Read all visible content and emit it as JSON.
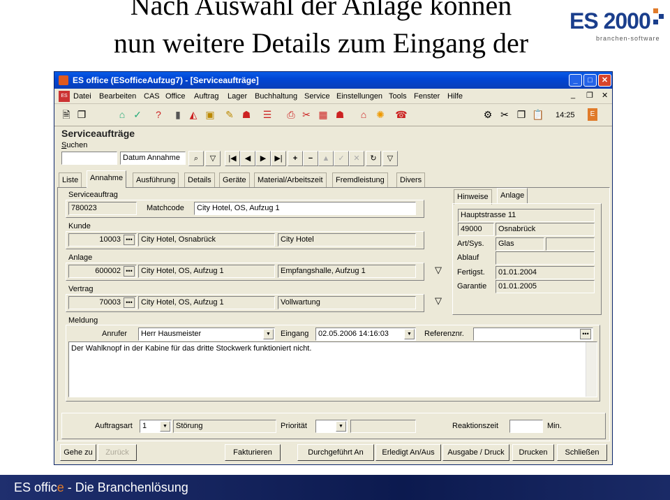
{
  "slide": {
    "title_line1": "Nach Auswahl der Anlage können",
    "title_line2": "nun weitere Details zum Eingang der",
    "logo_text": "ES 2000",
    "logo_sub": "branchen-software",
    "footer": "ES offic",
    "footer_e": "e",
    "footer_rest": " - Die Branchenlösung"
  },
  "window": {
    "title": "ES office (ESofficeAufzug7) - [Serviceaufträge]",
    "menu": [
      "Datei",
      "Bearbeiten",
      "CAS",
      "Office",
      "Auftrag",
      "Lager",
      "Buchhaltung",
      "Service",
      "Einstellungen",
      "Tools",
      "Fenster",
      "Hilfe"
    ],
    "clock": "14:25"
  },
  "form": {
    "title": "Serviceaufträge",
    "search_label": "Suchen",
    "search_value": "",
    "search_field": "Datum Annahme",
    "tabs": [
      "Liste",
      "Annahme",
      "Ausführung",
      "Details",
      "Geräte",
      "Material/Arbeitszeit",
      "Fremdleistung",
      "Divers"
    ],
    "right_tabs": [
      "Hinweise",
      "Anlage"
    ],
    "serviceauftrag": {
      "label": "Serviceauftrag",
      "nr": "780023",
      "matchcode_label": "Matchcode",
      "matchcode": "City Hotel, OS, Aufzug 1"
    },
    "kunde": {
      "label": "Kunde",
      "nr": "10003",
      "name": "City Hotel, Osnabrück",
      "short": "City Hotel"
    },
    "anlage": {
      "label": "Anlage",
      "nr": "600002",
      "name": "City Hotel, OS, Aufzug 1",
      "location": "Empfangshalle, Aufzug 1"
    },
    "vertrag": {
      "label": "Vertrag",
      "nr": "70003",
      "name": "City Hotel, OS, Aufzug 1",
      "type": "Vollwartung"
    },
    "anlage_info": {
      "street": "Hauptstrasse 11",
      "zip": "49000",
      "city": "Osnabrück",
      "artsys_label": "Art/Sys.",
      "artsys": "Glas",
      "ablauf_label": "Ablauf",
      "ablauf": "",
      "fertigst_label": "Fertigst.",
      "fertigst": "01.01.2004",
      "garantie_label": "Garantie",
      "garantie": "01.01.2005"
    },
    "meldung": {
      "label": "Meldung",
      "anrufer_label": "Anrufer",
      "anrufer": "Herr Hausmeister",
      "eingang_label": "Eingang",
      "eingang": "02.05.2006 14:16:03",
      "referenz_label": "Referenznr.",
      "referenz": "",
      "text": "Der Wahlknopf in der Kabine für das dritte Stockwerk funktioniert nicht."
    },
    "auftragsart_label": "Auftragsart",
    "auftragsart": "1",
    "auftragsart_text": "Störung",
    "prioritaet_label": "Priorität",
    "prioritaet": "",
    "reaktionszeit_label": "Reaktionszeit",
    "reaktionszeit": "",
    "reaktionszeit_unit": "Min."
  },
  "buttons": {
    "gehe_zu": "Gehe zu",
    "zurueck": "Zurück",
    "fakturieren": "Fakturieren",
    "durchgefuehrt": "Durchgeführt An",
    "erledigt": "Erledigt An/Aus",
    "ausgabe": "Ausgabe / Druck",
    "drucken": "Drucken",
    "schliessen": "Schließen"
  }
}
